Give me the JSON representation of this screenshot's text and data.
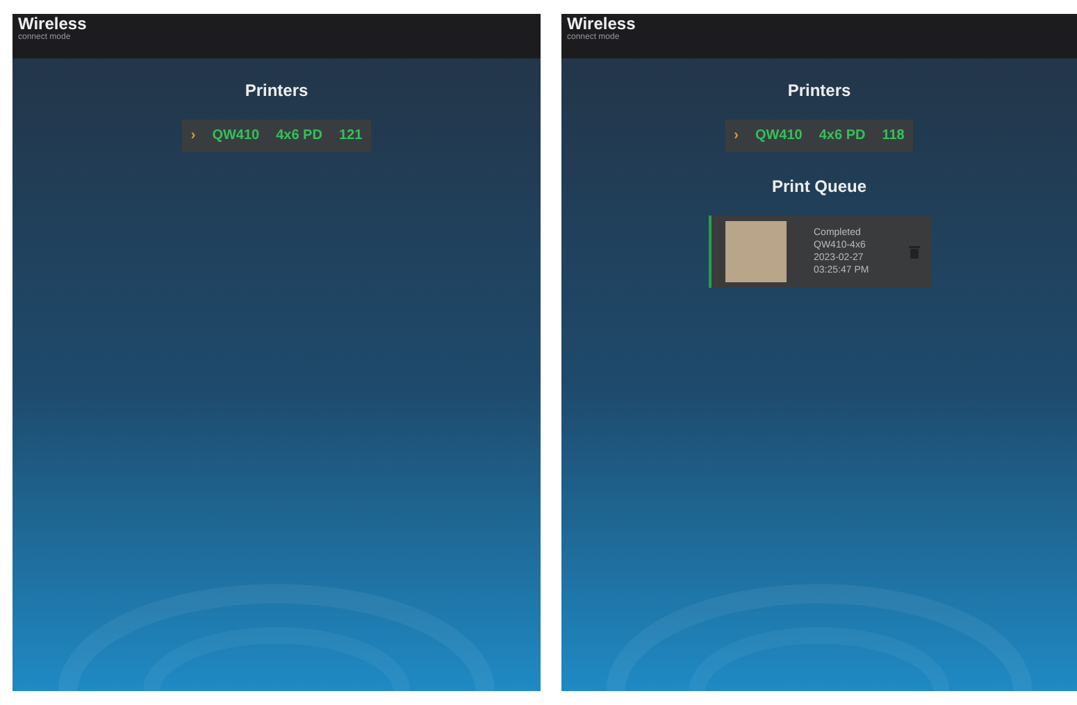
{
  "screens": [
    {
      "header": {
        "title": "Wireless",
        "subtitle": "connect mode"
      },
      "printers_heading": "Printers",
      "printers": [
        {
          "chevron": "›",
          "model": "QW410",
          "media": "4x6 PD",
          "count": "121"
        }
      ]
    },
    {
      "header": {
        "title": "Wireless",
        "subtitle": "connect mode"
      },
      "printers_heading": "Printers",
      "printers": [
        {
          "chevron": "›",
          "model": "QW410",
          "media": "4x6 PD",
          "count": "118"
        }
      ],
      "print_queue": {
        "heading": "Print Queue",
        "jobs": [
          {
            "status": "Completed",
            "printer": "QW410-4x6",
            "date": "2023-02-27",
            "time": "03:25:47 PM",
            "color": "#1fa34a"
          }
        ]
      }
    }
  ]
}
